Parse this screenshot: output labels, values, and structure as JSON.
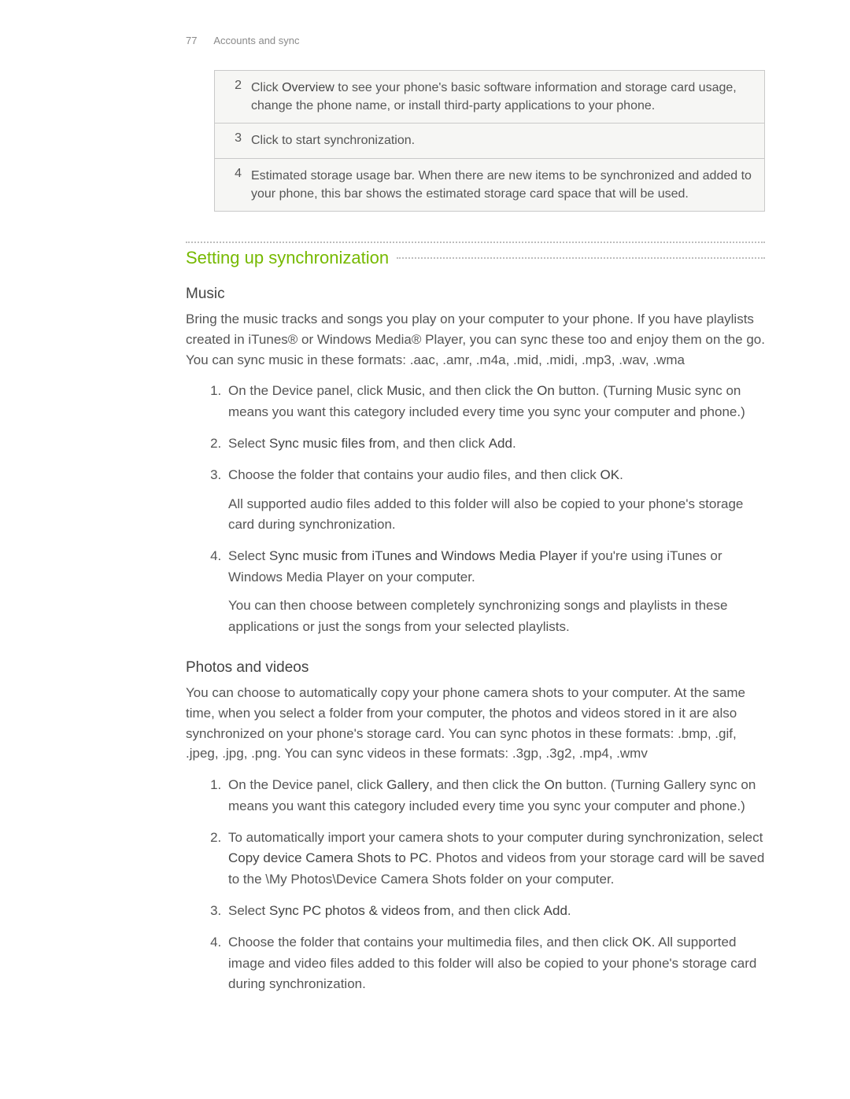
{
  "header": {
    "page_number": "77",
    "chapter": "Accounts and sync"
  },
  "table": {
    "rows": [
      {
        "num": "2",
        "text_pre": "Click ",
        "bold": "Overview",
        "text_post": " to see your phone's basic software information and storage card usage, change the phone name, or install third-party applications to your phone."
      },
      {
        "num": "3",
        "text_pre": "Click to start synchronization.",
        "bold": "",
        "text_post": ""
      },
      {
        "num": "4",
        "text_pre": "Estimated storage usage bar. When there are new items to be synchronized and added to your phone, this bar shows the estimated storage card space that will be used.",
        "bold": "",
        "text_post": ""
      }
    ]
  },
  "section_title": "Setting up synchronization",
  "music": {
    "heading": "Music",
    "intro": "Bring the music tracks and songs you play on your computer to your phone. If you have playlists created in iTunes® or Windows Media® Player, you can sync these too and enjoy them on the go. You can sync music in these formats: .aac, .amr, .m4a, .mid, .midi, .mp3, .wav, .wma",
    "steps": {
      "s1_a": "On the Device panel, click ",
      "s1_b": "Music",
      "s1_c": ", and then click the ",
      "s1_d": "On",
      "s1_e": " button. (Turning Music sync on means you want this category included every time you sync your computer and phone.)",
      "s2_a": "Select ",
      "s2_b": "Sync music files from",
      "s2_c": ", and then click ",
      "s2_d": "Add",
      "s2_e": ".",
      "s3_a": "Choose the folder that contains your audio files, and then click ",
      "s3_b": "OK",
      "s3_c": ".",
      "s3_p": "All supported audio files added to this folder will also be copied to your phone's storage card during synchronization.",
      "s4_a": "Select ",
      "s4_b": "Sync music from iTunes and Windows Media Player",
      "s4_c": " if you're using iTunes or Windows Media Player on your computer.",
      "s4_p": "You can then choose between completely synchronizing songs and playlists in these applications or just the songs from your selected playlists."
    }
  },
  "photos": {
    "heading": "Photos and videos",
    "intro": "You can choose to automatically copy your phone camera shots to your computer. At the same time, when you select a folder from your computer, the photos and videos stored in it are also synchronized on your phone's storage card. You can sync photos in these formats: .bmp, .gif, .jpeg, .jpg, .png. You can sync videos in these formats: .3gp, .3g2, .mp4, .wmv",
    "steps": {
      "s1_a": "On the Device panel, click ",
      "s1_b": "Gallery",
      "s1_c": ", and then click the ",
      "s1_d": "On",
      "s1_e": " button. (Turning Gallery sync on means you want this category included every time you sync your computer and phone.)",
      "s2_a": "To automatically import your camera shots to your computer during synchronization, select ",
      "s2_b": "Copy device Camera Shots to PC",
      "s2_c": ". Photos and videos from your storage card will be saved to the \\My Photos\\Device Camera Shots folder on your computer.",
      "s3_a": "Select ",
      "s3_b": "Sync PC photos & videos from",
      "s3_c": ", and then click ",
      "s3_d": "Add",
      "s3_e": ".",
      "s4_a": "Choose the folder that contains your multimedia files, and then click ",
      "s4_b": "OK",
      "s4_c": ". All supported image and video files added to this folder will also be copied to your phone's storage card during synchronization."
    }
  }
}
